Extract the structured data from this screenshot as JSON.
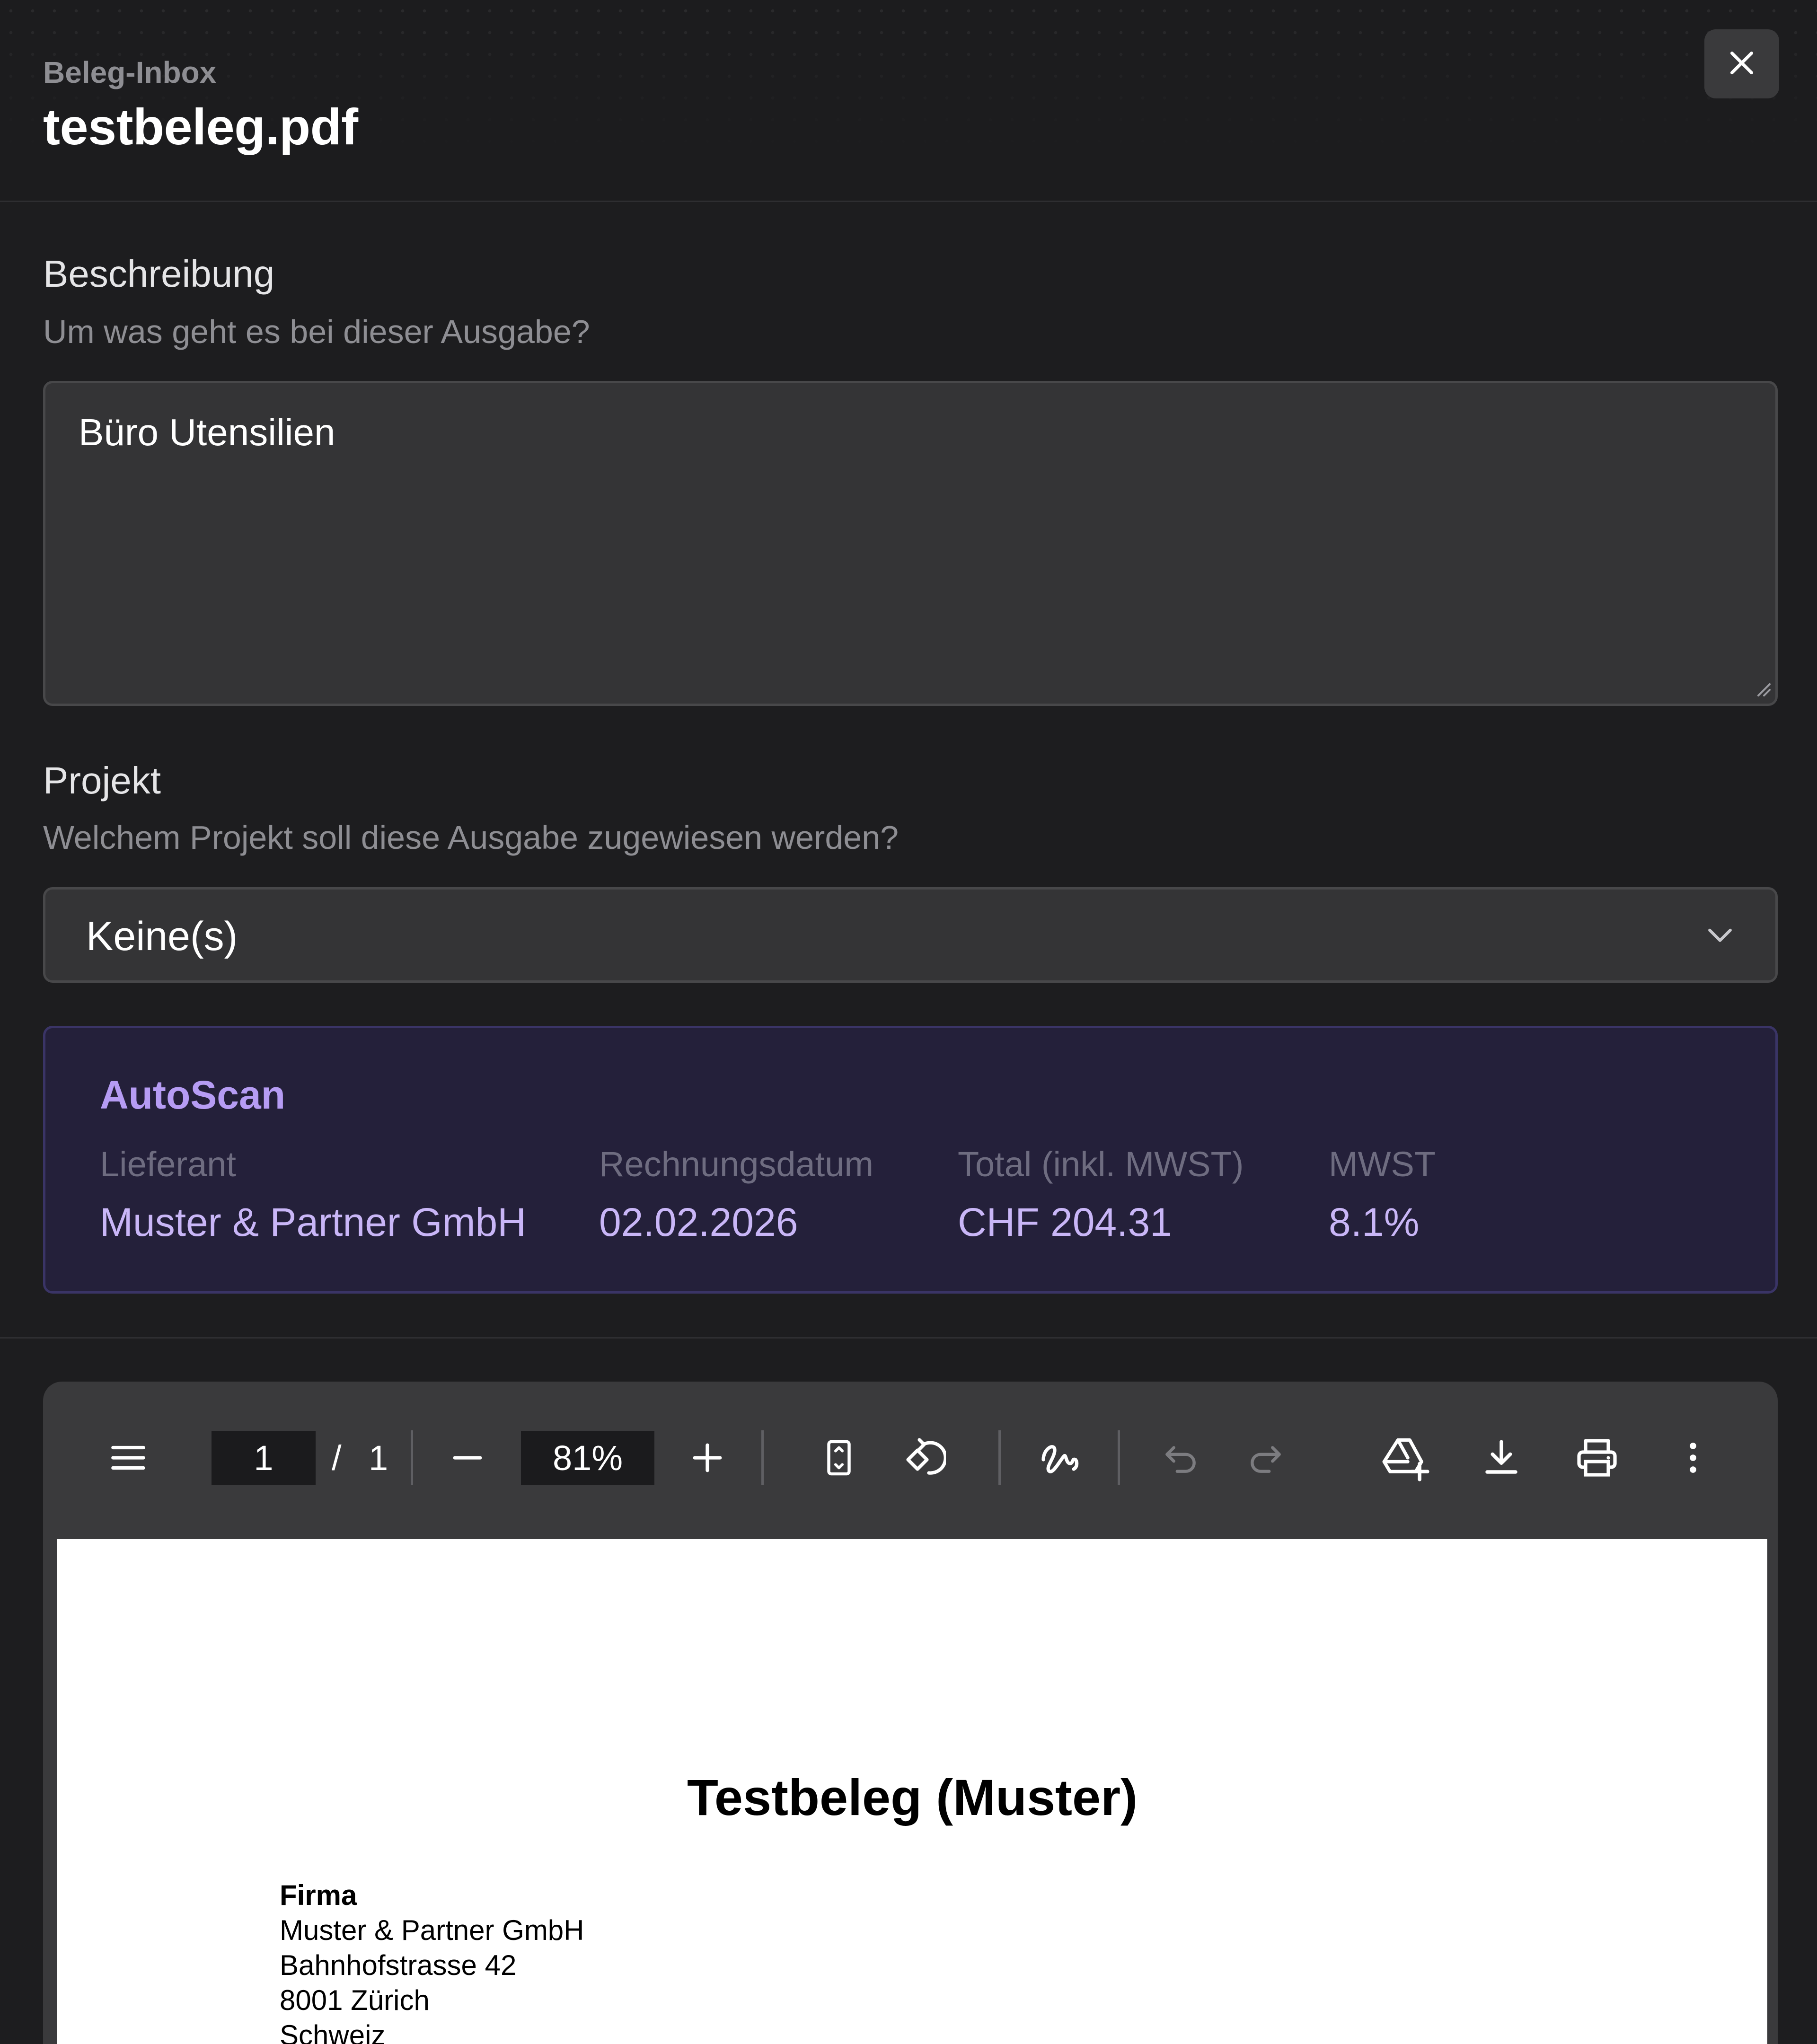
{
  "header": {
    "breadcrumb": "Beleg-Inbox",
    "title": "testbeleg.pdf",
    "close_icon": "close-icon"
  },
  "description": {
    "label": "Beschreibung",
    "help": "Um was geht es bei dieser Ausgabe?",
    "value": "Büro Utensilien"
  },
  "project": {
    "label": "Projekt",
    "help": "Welchem Projekt soll diese Ausgabe zugewiesen werden?",
    "selected": "Keine(s)"
  },
  "autoscan": {
    "title": "AutoScan",
    "fields": [
      {
        "label": "Lieferant",
        "value": "Muster & Partner GmbH"
      },
      {
        "label": "Rechnungsdatum",
        "value": "02.02.2026"
      },
      {
        "label": "Total (inkl. MWST)",
        "value": "CHF 204.31"
      },
      {
        "label": "MWST",
        "value": "8.1%"
      }
    ]
  },
  "viewer": {
    "current_page": "1",
    "page_separator": "/",
    "total_pages": "1",
    "zoom": "81%",
    "icons": [
      "menu-icon",
      "zoom-out-icon",
      "zoom-in-icon",
      "fit-page-icon",
      "rotate-icon",
      "annotate-icon",
      "undo-icon",
      "redo-icon",
      "drive-add-icon",
      "download-icon",
      "print-icon",
      "more-icon"
    ]
  },
  "pdf": {
    "heading": "Testbeleg (Muster)",
    "company_label": "Firma",
    "company_lines": [
      "Muster & Partner GmbH",
      "Bahnhofstrasse 42",
      "8001 Zürich",
      "Schweiz"
    ]
  },
  "colors": {
    "background": "#1d1d1f",
    "autoscan_accent": "#b69cf4",
    "autoscan_bg": "#24203a"
  }
}
